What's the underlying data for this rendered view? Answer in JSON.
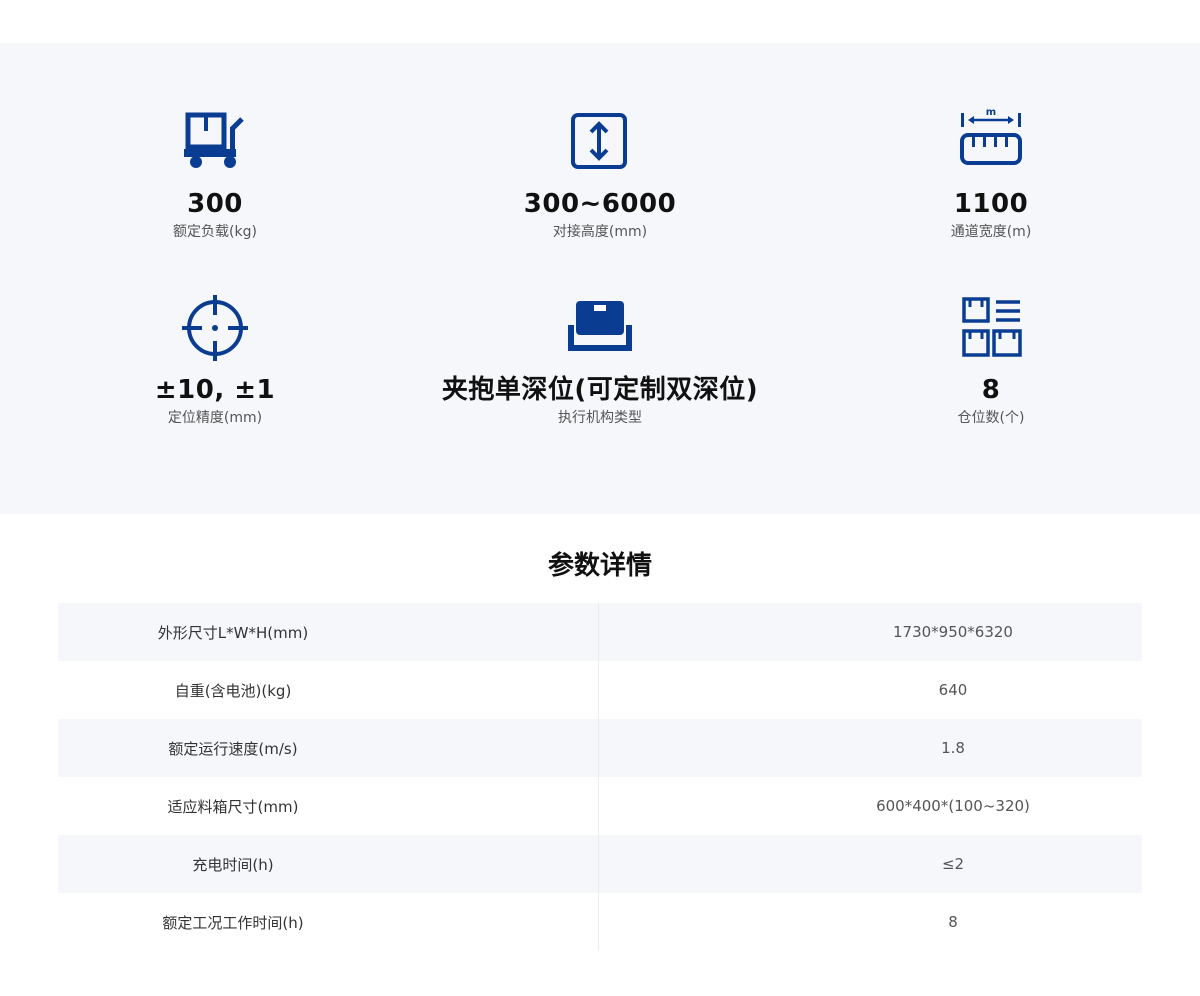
{
  "stats": [
    {
      "icon": "delivery-cart-icon",
      "value": "300",
      "label": "额定负载(kg)"
    },
    {
      "icon": "vertical-arrows-icon",
      "value": "300~6000",
      "label": "对接高度(mm)"
    },
    {
      "icon": "ruler-width-icon",
      "value": "1100",
      "label": "通道宽度(m)"
    },
    {
      "icon": "crosshair-icon",
      "value": "±10, ±1",
      "label": "定位精度(mm)"
    },
    {
      "icon": "box-gripper-icon",
      "value": "夹抱单深位(可定制双深位)",
      "label": "执行机构类型"
    },
    {
      "icon": "storage-slots-icon",
      "value": "8",
      "label": "仓位数(个)"
    }
  ],
  "ruler_unit": "m",
  "section_title": "参数详情",
  "specs": [
    {
      "name": "外形尺寸L*W*H(mm)",
      "value": "1730*950*6320"
    },
    {
      "name": "自重(含电池)(kg)",
      "value": "640"
    },
    {
      "name": "额定运行速度(m/s)",
      "value": "1.8"
    },
    {
      "name": "适应料箱尺寸(mm)",
      "value": "600*400*(100~320)"
    },
    {
      "name": "充电时间(h)",
      "value": "≤2"
    },
    {
      "name": "额定工况工作时间(h)",
      "value": "8"
    }
  ],
  "colors": {
    "accent": "#0a3d91",
    "panel_bg": "#f5f7fa",
    "row_alt_bg": "#f5f7fa"
  }
}
